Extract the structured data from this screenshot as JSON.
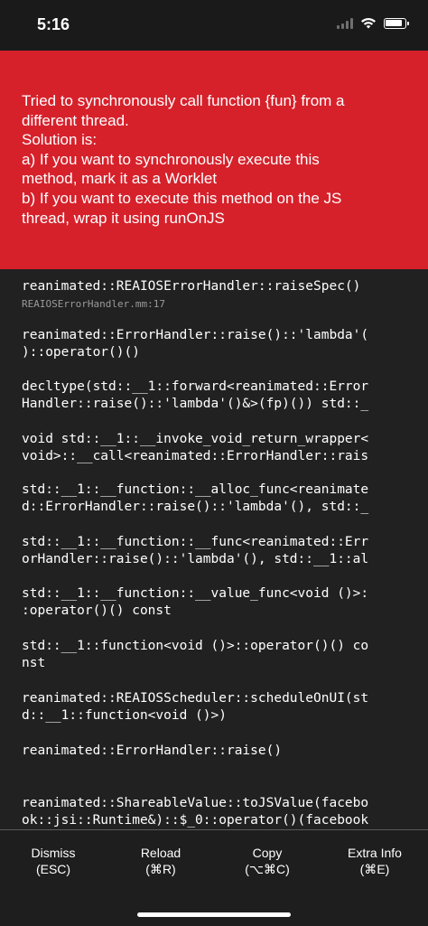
{
  "status_bar": {
    "time": "5:16"
  },
  "error": {
    "lines": [
      "Tried to synchronously call function {fun} from a",
      "different thread.",
      "Solution is:",
      "a) If you want to synchronously execute this",
      "method, mark it as a Worklet",
      "b) If you want to execute this method on the JS",
      "thread, wrap it using runOnJS"
    ]
  },
  "stack": [
    {
      "lines": [
        "reanimated::REAIOSErrorHandler::raiseSpec()"
      ],
      "file": "REAIOSErrorHandler.mm:17"
    },
    {
      "lines": [
        "reanimated::ErrorHandler::raise()::'lambda'(",
        ")::operator()()"
      ]
    },
    {
      "lines": [
        "decltype(std::__1::forward<reanimated::Error",
        "Handler::raise()::'lambda'()&>(fp)()) std::_"
      ]
    },
    {
      "lines": [
        "void std::__1::__invoke_void_return_wrapper<",
        "void>::__call<reanimated::ErrorHandler::rais"
      ]
    },
    {
      "lines": [
        "std::__1::__function::__alloc_func<reanimate",
        "d::ErrorHandler::raise()::'lambda'(), std::_"
      ]
    },
    {
      "lines": [
        "std::__1::__function::__func<reanimated::Err",
        "orHandler::raise()::'lambda'(), std::__1::al"
      ]
    },
    {
      "lines": [
        "std::__1::__function::__value_func<void ()>:",
        ":operator()() const"
      ]
    },
    {
      "lines": [
        "std::__1::function<void ()>::operator()() co",
        "nst"
      ]
    },
    {
      "lines": [
        "reanimated::REAIOSScheduler::scheduleOnUI(st",
        "d::__1::function<void ()>)"
      ]
    },
    {
      "lines": [
        "reanimated::ErrorHandler::raise()"
      ]
    },
    {
      "lines": [
        "reanimated::ShareableValue::toJSValue(facebo",
        "ok::jsi::Runtime&)::$_0::operator()(facebook"
      ]
    }
  ],
  "toolbar": {
    "dismiss": {
      "label": "Dismiss",
      "shortcut": "(ESC)"
    },
    "reload": {
      "label": "Reload",
      "shortcut": "(⌘R)"
    },
    "copy": {
      "label": "Copy",
      "shortcut": "(⌥⌘C)"
    },
    "extra_info": {
      "label": "Extra Info",
      "shortcut": "(⌘E)"
    }
  },
  "colors": {
    "banner": "#d6212b",
    "background": "#212121",
    "file_text": "#9a9a9a"
  }
}
